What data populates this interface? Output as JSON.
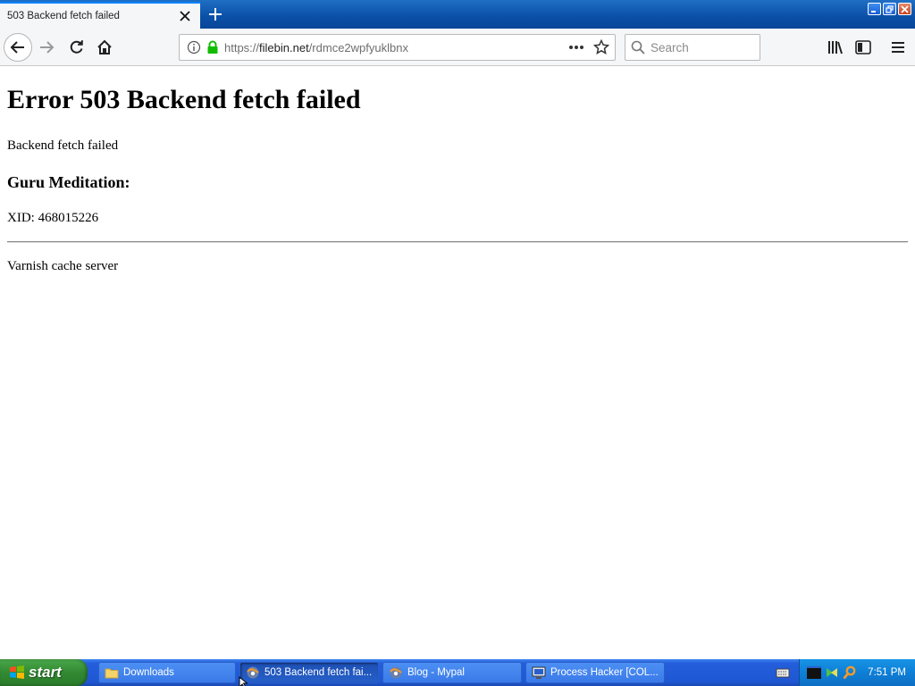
{
  "browser": {
    "tab": {
      "title": "503 Backend fetch failed"
    },
    "url": {
      "prefix": "https://",
      "host": "filebin.net",
      "path": "/rdmce2wpfyuklbnx"
    },
    "search": {
      "placeholder": "Search"
    }
  },
  "page": {
    "heading": "Error 503 Backend fetch failed",
    "message": "Backend fetch failed",
    "subheading": "Guru Meditation:",
    "xid": "XID: 468015226",
    "footer": "Varnish cache server"
  },
  "taskbar": {
    "start_label": "start",
    "tasks": [
      {
        "label": "Downloads",
        "icon": "folder-icon"
      },
      {
        "label": "503 Backend fetch fai...",
        "icon": "browser-icon"
      },
      {
        "label": "Blog - Mypal",
        "icon": "browser-icon"
      },
      {
        "label": "Process Hacker [COL...",
        "icon": "monitor-icon"
      }
    ],
    "clock": "7:51 PM"
  },
  "colors": {
    "tab_accent": "#0a84ff",
    "lock_green": "#12bc00",
    "taskbar_blue": "#245edb",
    "start_green": "#328a32"
  }
}
